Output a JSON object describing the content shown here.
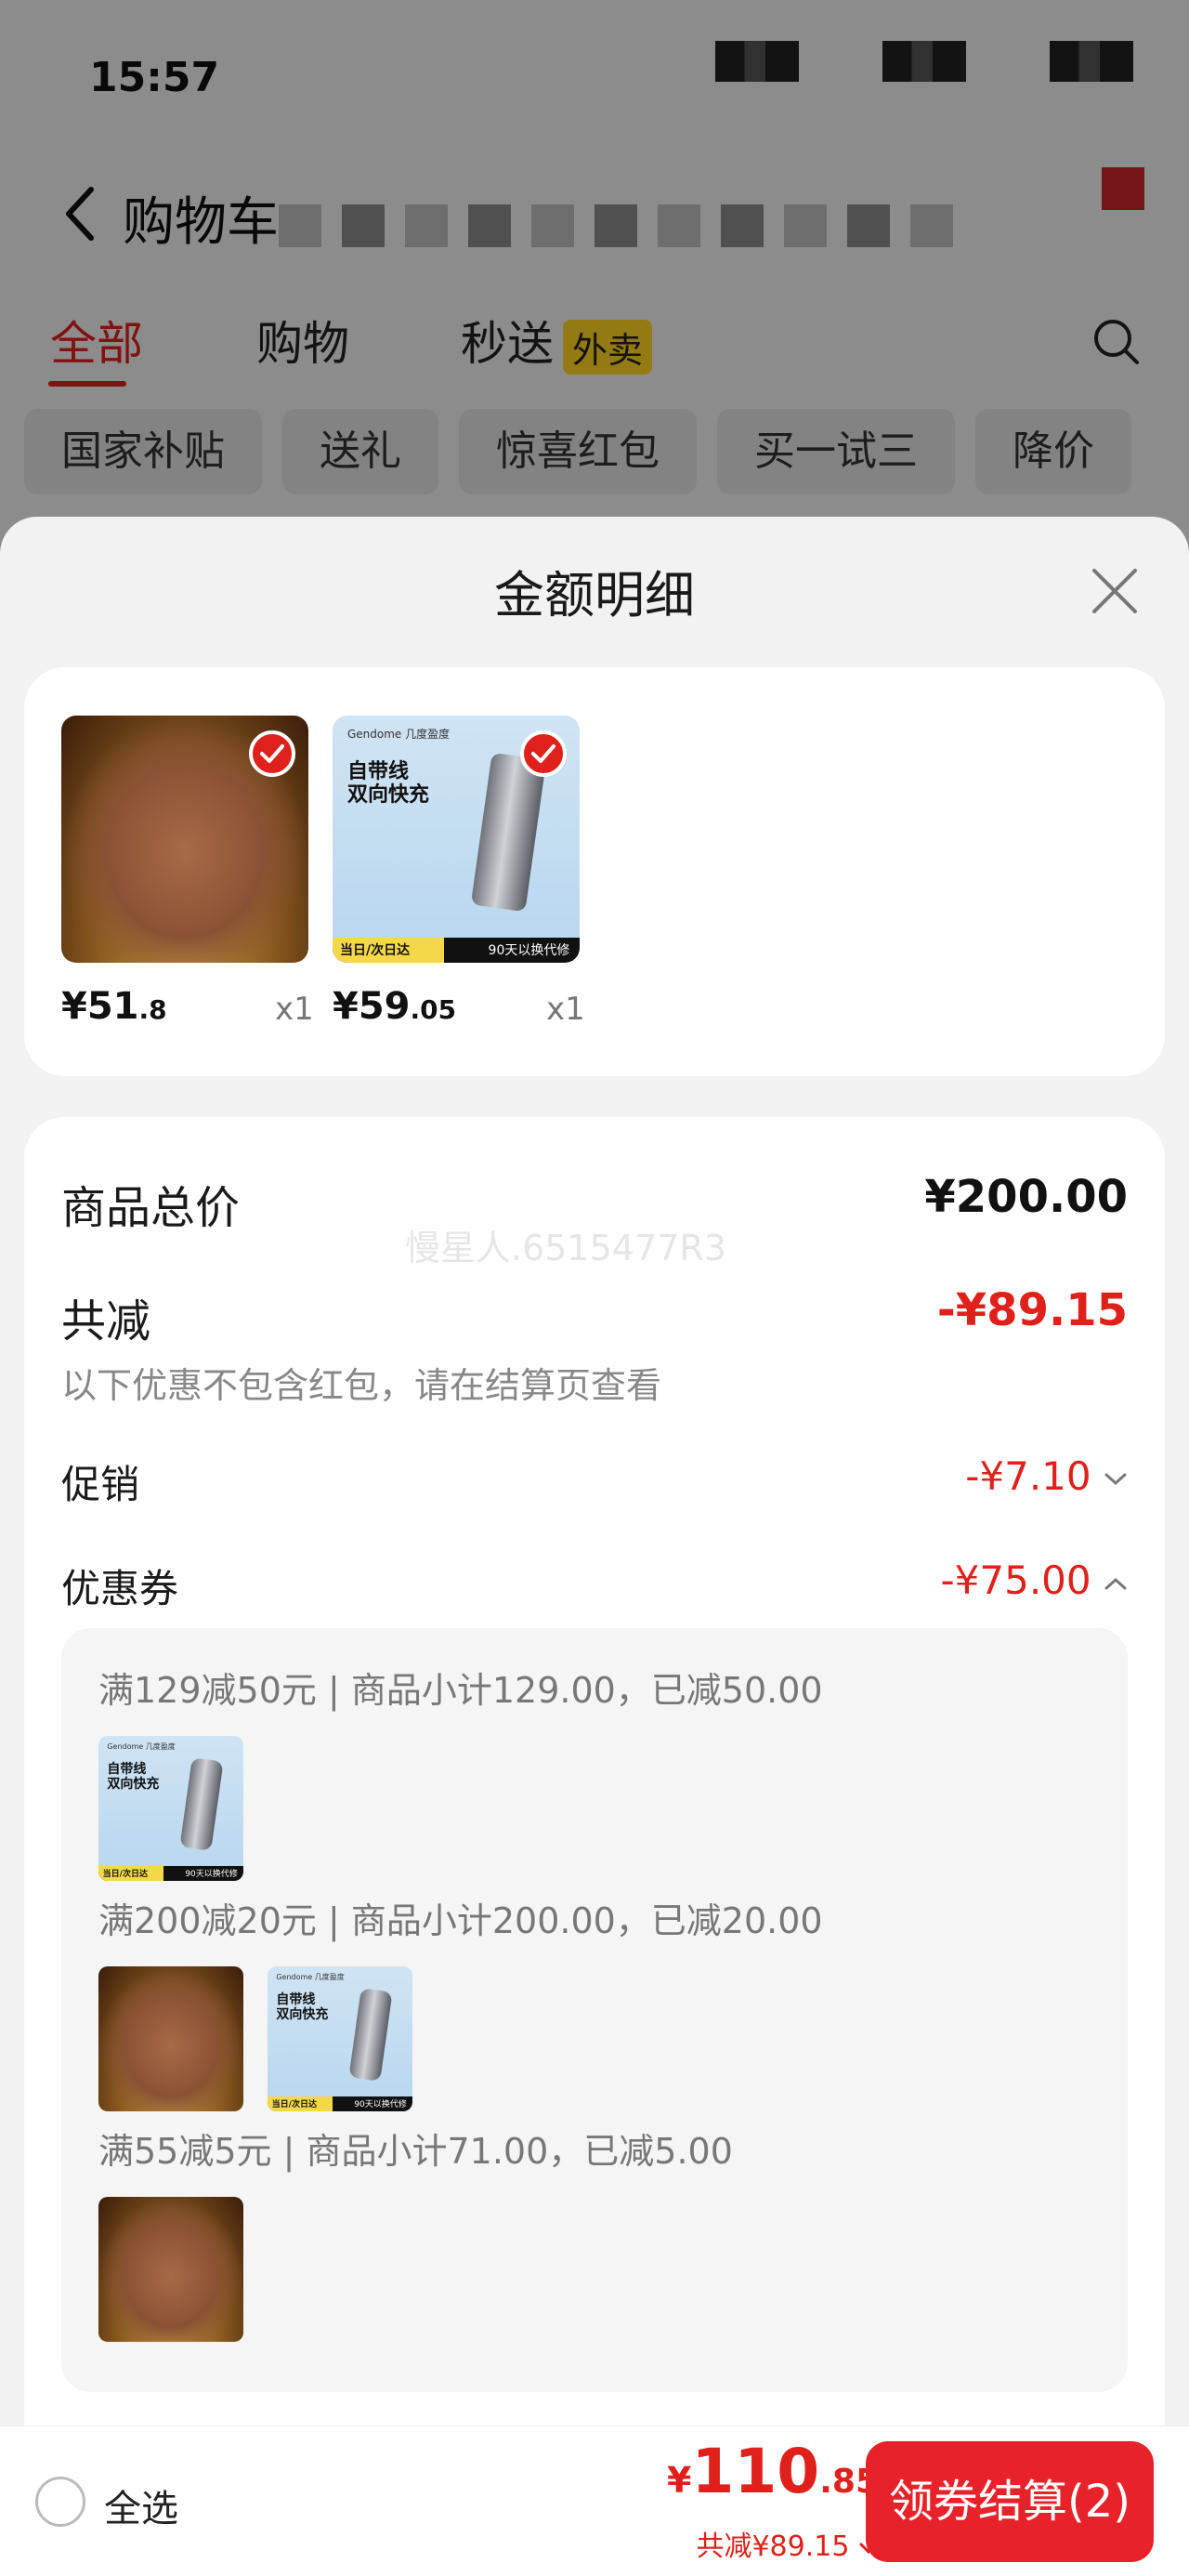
{
  "status_bar": {
    "time": "15:57"
  },
  "cart_header": {
    "title": "购物车"
  },
  "cart_tabs": [
    {
      "label": "全部",
      "active": true
    },
    {
      "label": "购物",
      "active": false
    },
    {
      "label": "秒送",
      "badge": "外卖",
      "active": false
    }
  ],
  "filter_chips": [
    "国家补贴",
    "送礼",
    "惊喜红包",
    "买一试三",
    "降价"
  ],
  "sheet": {
    "title": "金额明细",
    "products": [
      {
        "price_int": "¥51",
        "price_dec": ".8",
        "qty": "x1",
        "image": "cocoa-powder"
      },
      {
        "price_int": "¥59",
        "price_dec": ".05",
        "qty": "x1",
        "image": "power-bank",
        "image_text": {
          "brand": "Gendome 几度盈度",
          "headline": "自带线\n双向快充",
          "bar_left": "当日/次日达",
          "bar_right": "90天以换代修"
        }
      }
    ],
    "summary": {
      "total_label": "商品总价",
      "total_value": "¥200.00",
      "watermark": "慢星人.6515477R3",
      "reduce_label": "共减",
      "reduce_value": "-¥89.15",
      "reduce_note": "以下优惠不包含红包，请在结算页查看",
      "promo_label": "促销",
      "promo_value": "-¥7.10",
      "coupon_label": "优惠券",
      "coupon_value": "-¥75.00"
    },
    "coupons": [
      {
        "text": "满129减50元 | 商品小计129.00，已减50.00",
        "items": [
          "power-bank"
        ]
      },
      {
        "text": "满200减20元 | 商品小计200.00，已减20.00",
        "items": [
          "cocoa-powder",
          "power-bank"
        ]
      },
      {
        "text": "满55减5元 | 商品小计71.00，已减5.00",
        "items": [
          "cocoa-powder"
        ]
      }
    ]
  },
  "footer": {
    "select_all": "全选",
    "currency": "¥",
    "total_int": "110",
    "total_dec": ".85",
    "total_reduce": "共减¥89.15",
    "checkout_label": "领券结算(2)"
  },
  "colors": {
    "accent_red": "#e0201b",
    "checkout_red": "#e8222a",
    "badge_yellow": "#ffd21f"
  }
}
